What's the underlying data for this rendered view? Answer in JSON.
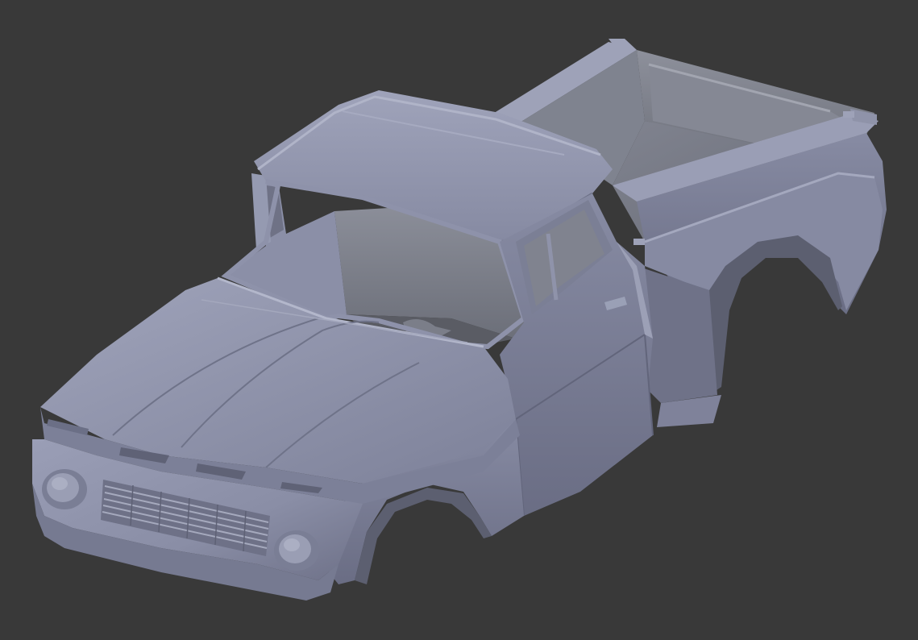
{
  "viewport": {
    "background": "#393939",
    "model_color": "#8a8ea6",
    "model_shadow": "#5f6276",
    "model_highlight": "#a3a7bf",
    "interior_color": "#7a7d8a",
    "interior_dark": "#5e6068",
    "interior_light": "#8e919c"
  }
}
